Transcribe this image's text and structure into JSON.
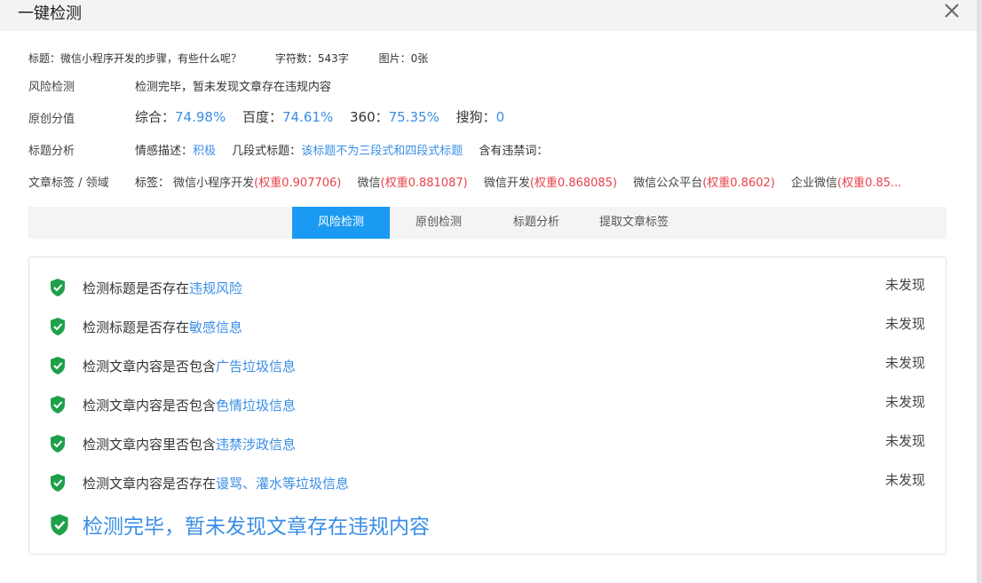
{
  "window": {
    "title": "一键检测"
  },
  "summary": {
    "title_text": "标题：微信小程序开发的步骤，有些什么呢？",
    "char_count": "字符数：543字",
    "image_count": "图片：0张"
  },
  "risk": {
    "label": "风险检测",
    "value": "检测完毕，暂未发现文章存在违规内容"
  },
  "originality": {
    "label": "原创分值",
    "scores": [
      {
        "name": "综合：",
        "value": "74.98%"
      },
      {
        "name": "百度：",
        "value": "74.61%"
      },
      {
        "name": "360：",
        "value": "75.35%"
      },
      {
        "name": "搜狗：",
        "value": "0"
      }
    ]
  },
  "title_analysis": {
    "label": "标题分析",
    "sentiment_label": "情感描述：",
    "sentiment_value": "积极",
    "segment_label": "几段式标题：",
    "segment_value": "该标题不为三段式和四段式标题",
    "banned_label": "含有违禁词："
  },
  "tags": {
    "label": "文章标签 / 领域",
    "prefix": "标签：",
    "items": [
      {
        "name": "微信小程序开发",
        "weight": "(权重0.907706)"
      },
      {
        "name": "微信",
        "weight": "(权重0.881087)"
      },
      {
        "name": "微信开发",
        "weight": "(权重0.868085)"
      },
      {
        "name": "微信公众平台",
        "weight": "(权重0.8602)"
      },
      {
        "name": "企业微信",
        "weight": "(权重0.85..."
      }
    ]
  },
  "tabs": [
    "风险检测",
    "原创检测",
    "标题分析",
    "提取文章标签"
  ],
  "checks": [
    {
      "prefix": "检测标题是否存在",
      "highlight": "违规风险",
      "status": "未发现"
    },
    {
      "prefix": "检测标题是否存在",
      "highlight": "敏感信息",
      "status": "未发现"
    },
    {
      "prefix": "检测文章内容是否包含",
      "highlight": "广告垃圾信息",
      "status": "未发现"
    },
    {
      "prefix": "检测文章内容是否包含",
      "highlight": "色情垃圾信息",
      "status": "未发现"
    },
    {
      "prefix": "检测文章内容里否包含",
      "highlight": "违禁涉政信息",
      "status": "未发现"
    },
    {
      "prefix": "检测文章内容是否存在",
      "highlight": "谩骂、灌水等垃圾信息",
      "status": "未发现"
    }
  ],
  "final_message": "检测完毕，暂未发现文章存在违规内容",
  "colors": {
    "accent": "#3a8ee6",
    "tab_active": "#1a9af2",
    "shield": "#1fa04b",
    "weight": "#e8424a"
  },
  "icons": {
    "close": "close-icon",
    "check": "shield-check-icon"
  }
}
